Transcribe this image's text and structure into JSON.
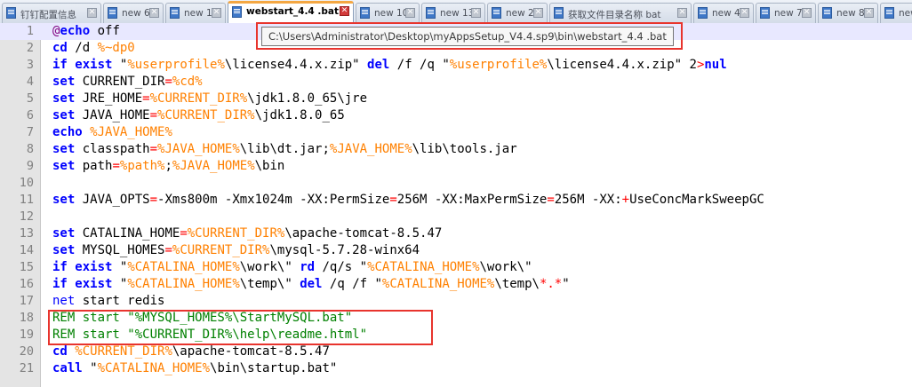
{
  "tabs": [
    {
      "label": "钉钉配置信息",
      "active": false
    },
    {
      "label": "new 6",
      "active": false
    },
    {
      "label": "new 1",
      "active": false
    },
    {
      "label": "webstart_4.4 .bat",
      "active": true
    },
    {
      "label": "new 10",
      "active": false
    },
    {
      "label": "new 13",
      "active": false
    },
    {
      "label": "new 2",
      "active": false
    },
    {
      "label": "获取文件目录名称 bat",
      "active": false
    },
    {
      "label": "new 4",
      "active": false
    },
    {
      "label": "new 7",
      "active": false
    },
    {
      "label": "new 8",
      "active": false
    },
    {
      "label": "new",
      "active": false
    }
  ],
  "tooltip": "C:\\Users\\Administrator\\Desktop\\myAppsSetup_V4.4.sp9\\bin\\webstart_4.4 .bat",
  "lines": [
    {
      "n": "1",
      "tokens": [
        [
          "at",
          "@"
        ],
        [
          "kw",
          "echo"
        ],
        [
          "text",
          " off"
        ]
      ]
    },
    {
      "n": "2",
      "tokens": [
        [
          "kw",
          "cd"
        ],
        [
          "text",
          " /d "
        ],
        [
          "var",
          "%~dp0"
        ]
      ]
    },
    {
      "n": "3",
      "tokens": [
        [
          "kw",
          "if"
        ],
        [
          "text",
          " "
        ],
        [
          "kw",
          "exist"
        ],
        [
          "text",
          " \""
        ],
        [
          "var",
          "%userprofile%"
        ],
        [
          "text",
          "\\license4.4.x.zip\" "
        ],
        [
          "kw",
          "del"
        ],
        [
          "text",
          " /f /q \""
        ],
        [
          "var",
          "%userprofile%"
        ],
        [
          "text",
          "\\license4.4.x.zip\" 2"
        ],
        [
          "op",
          ">"
        ],
        [
          "kw",
          "nul"
        ]
      ]
    },
    {
      "n": "4",
      "tokens": [
        [
          "kw",
          "set"
        ],
        [
          "text",
          " CURRENT_DIR"
        ],
        [
          "op",
          "="
        ],
        [
          "var",
          "%cd%"
        ]
      ]
    },
    {
      "n": "5",
      "tokens": [
        [
          "kw",
          "set"
        ],
        [
          "text",
          " JRE_HOME"
        ],
        [
          "op",
          "="
        ],
        [
          "var",
          "%CURRENT_DIR%"
        ],
        [
          "text",
          "\\jdk1.8.0_65\\jre"
        ]
      ]
    },
    {
      "n": "6",
      "tokens": [
        [
          "kw",
          "set"
        ],
        [
          "text",
          " JAVA_HOME"
        ],
        [
          "op",
          "="
        ],
        [
          "var",
          "%CURRENT_DIR%"
        ],
        [
          "text",
          "\\jdk1.8.0_65"
        ]
      ]
    },
    {
      "n": "7",
      "tokens": [
        [
          "kw",
          "echo"
        ],
        [
          "text",
          " "
        ],
        [
          "var",
          "%JAVA_HOME%"
        ]
      ]
    },
    {
      "n": "8",
      "tokens": [
        [
          "kw",
          "set"
        ],
        [
          "text",
          " classpath"
        ],
        [
          "op",
          "="
        ],
        [
          "var",
          "%JAVA_HOME%"
        ],
        [
          "text",
          "\\lib\\dt.jar;"
        ],
        [
          "var",
          "%JAVA_HOME%"
        ],
        [
          "text",
          "\\lib\\tools.jar"
        ]
      ]
    },
    {
      "n": "9",
      "tokens": [
        [
          "kw",
          "set"
        ],
        [
          "text",
          " path"
        ],
        [
          "op",
          "="
        ],
        [
          "var",
          "%path%"
        ],
        [
          "text",
          ";"
        ],
        [
          "var",
          "%JAVA_HOME%"
        ],
        [
          "text",
          "\\bin"
        ]
      ]
    },
    {
      "n": "10",
      "tokens": []
    },
    {
      "n": "11",
      "tokens": [
        [
          "kw",
          "set"
        ],
        [
          "text",
          " JAVA_OPTS"
        ],
        [
          "op",
          "="
        ],
        [
          "text",
          "-Xms800m -Xmx1024m -XX:PermSize"
        ],
        [
          "op",
          "="
        ],
        [
          "text",
          "256M -XX:MaxPermSize"
        ],
        [
          "op",
          "="
        ],
        [
          "text",
          "256M -XX:"
        ],
        [
          "op",
          "+"
        ],
        [
          "text",
          "UseConcMarkSweepGC"
        ]
      ]
    },
    {
      "n": "12",
      "tokens": []
    },
    {
      "n": "13",
      "tokens": [
        [
          "kw",
          "set"
        ],
        [
          "text",
          " CATALINA_HOME"
        ],
        [
          "op",
          "="
        ],
        [
          "var",
          "%CURRENT_DIR%"
        ],
        [
          "text",
          "\\apache-tomcat-8.5.47"
        ]
      ]
    },
    {
      "n": "14",
      "tokens": [
        [
          "kw",
          "set"
        ],
        [
          "text",
          " MYSQL_HOMES"
        ],
        [
          "op",
          "="
        ],
        [
          "var",
          "%CURRENT_DIR%"
        ],
        [
          "text",
          "\\mysql-5.7.28-winx64"
        ]
      ]
    },
    {
      "n": "15",
      "tokens": [
        [
          "kw",
          "if"
        ],
        [
          "text",
          " "
        ],
        [
          "kw",
          "exist"
        ],
        [
          "text",
          " \""
        ],
        [
          "var",
          "%CATALINA_HOME%"
        ],
        [
          "text",
          "\\work\\\" "
        ],
        [
          "kw",
          "rd"
        ],
        [
          "text",
          " /q/s \""
        ],
        [
          "var",
          "%CATALINA_HOME%"
        ],
        [
          "text",
          "\\work\\\""
        ]
      ]
    },
    {
      "n": "16",
      "tokens": [
        [
          "kw",
          "if"
        ],
        [
          "text",
          " "
        ],
        [
          "kw",
          "exist"
        ],
        [
          "text",
          " \""
        ],
        [
          "var",
          "%CATALINA_HOME%"
        ],
        [
          "text",
          "\\temp\\\" "
        ],
        [
          "kw",
          "del"
        ],
        [
          "text",
          " /q /f \""
        ],
        [
          "var",
          "%CATALINA_HOME%"
        ],
        [
          "text",
          "\\temp\\"
        ],
        [
          "op",
          "*.*"
        ],
        [
          "text",
          "\""
        ]
      ]
    },
    {
      "n": "17",
      "tokens": [
        [
          "cmd",
          "net"
        ],
        [
          "text",
          " start redis"
        ]
      ]
    },
    {
      "n": "18",
      "tokens": [
        [
          "rem",
          "REM start \"%MYSQL_HOMES%\\StartMySQL.bat\""
        ]
      ]
    },
    {
      "n": "19",
      "tokens": [
        [
          "rem",
          "REM start \"%CURRENT_DIR%\\help\\readme.html\""
        ]
      ]
    },
    {
      "n": "20",
      "tokens": [
        [
          "kw",
          "cd"
        ],
        [
          "text",
          " "
        ],
        [
          "var",
          "%CURRENT_DIR%"
        ],
        [
          "text",
          "\\apache-tomcat-8.5.47"
        ]
      ]
    },
    {
      "n": "21",
      "tokens": [
        [
          "kw",
          "call"
        ],
        [
          "text",
          " \""
        ],
        [
          "var",
          "%CATALINA_HOME%"
        ],
        [
          "text",
          "\\bin\\startup.bat\""
        ]
      ]
    }
  ]
}
